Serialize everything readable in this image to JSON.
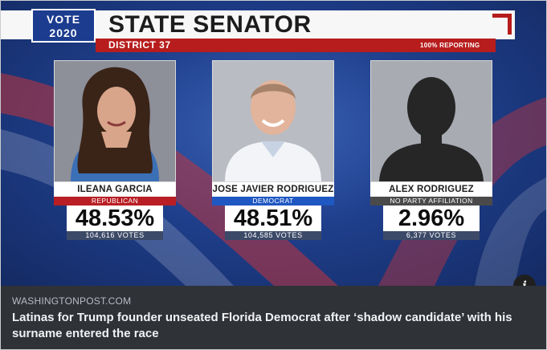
{
  "graphic": {
    "vote_line1": "VOTE",
    "vote_line2": "2020",
    "title": "STATE SENATOR",
    "district": "DISTRICT 37",
    "reporting": "100% REPORTING",
    "candidates": [
      {
        "name": "ILEANA GARCIA",
        "party": "REPUBLICAN",
        "percent": "48.53%",
        "votes": "104,616 VOTES",
        "party_color": "#b81e24"
      },
      {
        "name": "JOSE JAVIER RODRIGUEZ",
        "party": "DEMOCRAT",
        "percent": "48.51%",
        "votes": "104,585 VOTES",
        "party_color": "#1f57c3"
      },
      {
        "name": "ALEX RODRIGUEZ",
        "party": "NO PARTY AFFILIATION",
        "percent": "2.96%",
        "votes": "6,377 VOTES",
        "party_color": "#4a4a4a"
      }
    ]
  },
  "link_preview": {
    "source": "WASHINGTONPOST.COM",
    "headline": "Latinas for Trump founder unseated Florida Democrat after ‘shadow candidate’ with his surname entered the race",
    "info_icon": "i"
  }
}
